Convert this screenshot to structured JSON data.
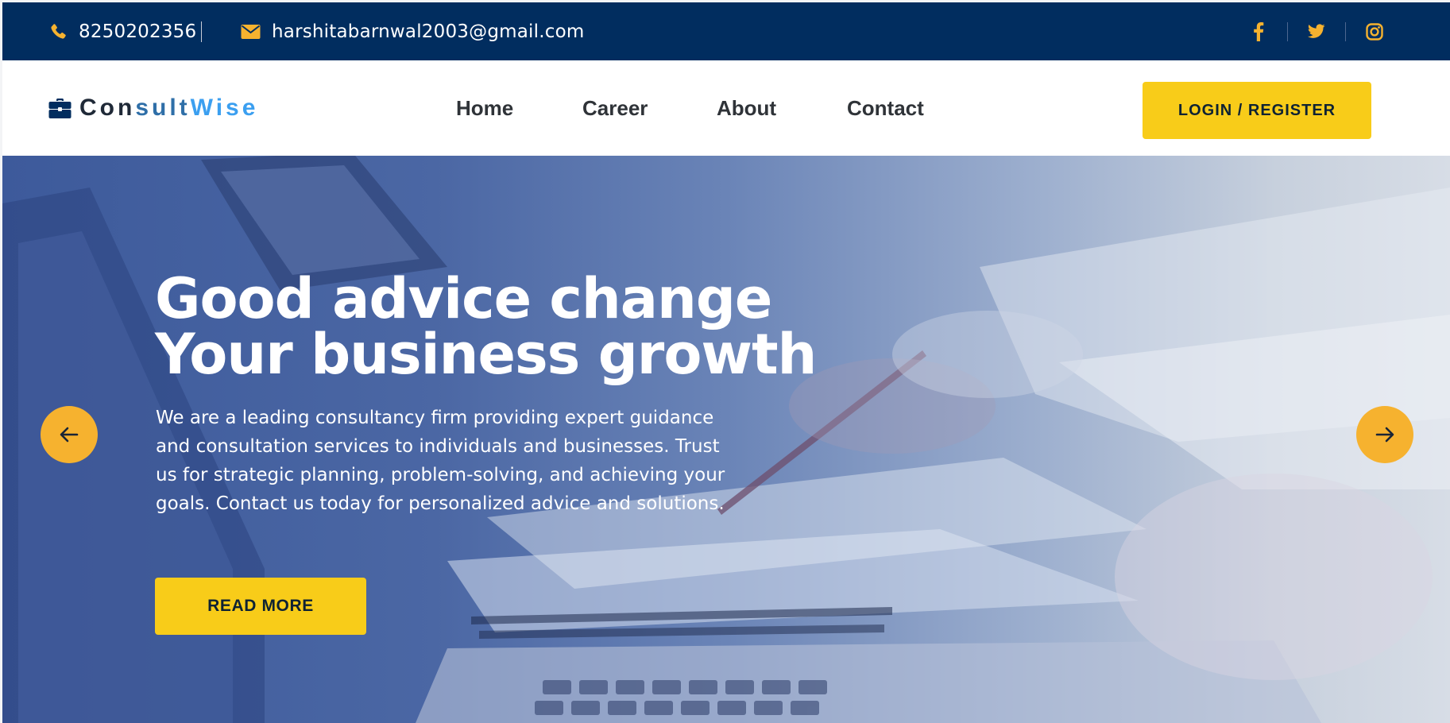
{
  "topbar": {
    "phone": "8250202356",
    "email": "harshitabarnwal2003@gmail.com",
    "icons": [
      "phone-icon",
      "envelope-icon",
      "facebook-icon",
      "twitter-icon",
      "instagram-icon"
    ]
  },
  "navbar": {
    "logo": {
      "part1": "Con",
      "part2": "sult",
      "part3": "Wise",
      "icon": "briefcase-icon"
    },
    "links": [
      "Home",
      "Career",
      "About",
      "Contact"
    ],
    "login_label": "LOGIN / REGISTER"
  },
  "hero": {
    "title_line1": "Good advice change",
    "title_line2": "Your business growth",
    "description": "We are a leading consultancy firm providing expert guidance and consultation services to individuals and businesses. Trust us for strategic planning, problem-solving, and achieving your goals. Contact us today for personalized advice and solutions.",
    "button_label": "READ MORE",
    "prev_icon": "arrow-left-icon",
    "next_icon": "arrow-right-icon"
  },
  "colors": {
    "topbar_bg": "#012d5f",
    "accent_yellow": "#f8cc19",
    "accent_orange": "#f6b22f",
    "logo_blue": "#3b9ff0",
    "hero_overlay": "#3d5a9b"
  }
}
